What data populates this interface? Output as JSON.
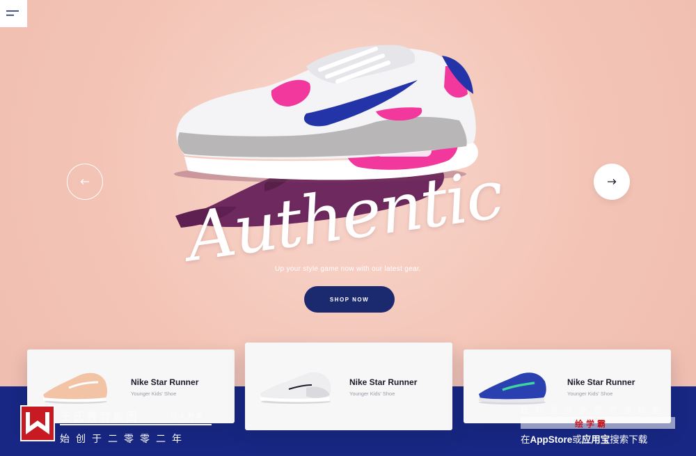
{
  "hero": {
    "headline": "Authentic",
    "subtitle": "Up your style game now with our latest gear.",
    "cta_label": "SHOP NOW"
  },
  "icons": {
    "menu": "menu-icon",
    "prev": "arrow-left-icon",
    "next": "arrow-right-icon"
  },
  "products": [
    {
      "title": "Nike Star Runner",
      "subtitle": "Younger Kids' Shoe",
      "shoe_color": "#f3c3a6"
    },
    {
      "title": "Nike Star Runner",
      "subtitle": "Younger Kids' Shoe",
      "shoe_color": "#eeeef0"
    },
    {
      "title": "Nike Star Runner",
      "subtitle": "Younger Kids' Shoe",
      "shoe_color": "#2a3fb0"
    }
  ],
  "watermark": {
    "org_name": "王氏教育集团",
    "motto": "以人为本",
    "founded": "始创于二零零二年",
    "promo": "获取更多免费资源数据",
    "brand": "绘学霸",
    "store_prefix": "在",
    "store_a": "AppStore",
    "store_or": "或",
    "store_b": "应用宝",
    "store_suffix": "搜索下载"
  },
  "colors": {
    "background": "#f4c9bc",
    "navy": "#172783",
    "button": "#1b2a6f",
    "accent_pink": "#f2389c",
    "swoosh_blue": "#2334a8"
  }
}
